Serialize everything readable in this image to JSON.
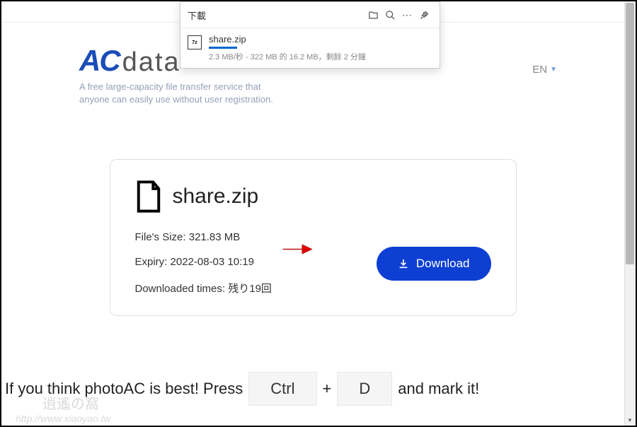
{
  "popup": {
    "title": "下載",
    "item": {
      "filename": "share.zip",
      "status": "2.3 MB/秒 - 322 MB 的 16.2 MB，剩餘 2 分鐘"
    }
  },
  "logo": {
    "ac": "AC",
    "data": "data"
  },
  "tagline": "A free large-capacity file transfer service that\nanyone can easily use without user registration.",
  "lang": {
    "label": "EN"
  },
  "file": {
    "name": "share.zip",
    "size_label": "File's Size:",
    "size_value": "321.83 MB",
    "expiry_label": "Expiry:",
    "expiry_value": "2022-08-03 10:19",
    "downloads_label": "Downloaded times:",
    "downloads_value": "残り19回"
  },
  "download_button": "Download",
  "bookmark": {
    "prefix": "If you think photoAC is best! Press",
    "key1": "Ctrl",
    "plus": "+",
    "key2": "D",
    "suffix": "and mark it!"
  },
  "watermark": {
    "url": "http://www.xiaoyao.tw",
    "cn": "逍遙の窩"
  }
}
